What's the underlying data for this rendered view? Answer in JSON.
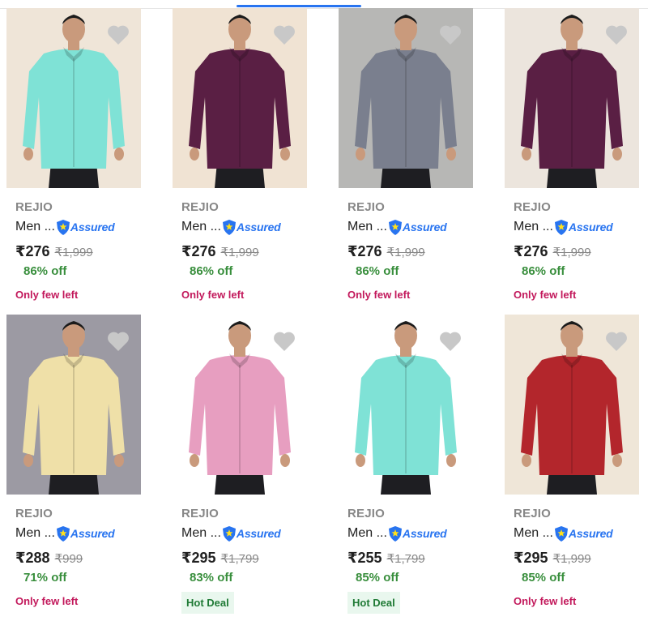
{
  "colors": {
    "accent": "#2874f0",
    "discount": "#388e3c",
    "scarcity": "#c2185b",
    "hot_deal_bg": "#e9f7ee"
  },
  "assured_label": "Assured",
  "products": [
    {
      "brand": "REJIO",
      "title": "Men ...",
      "price": "₹276",
      "mrp": "₹1,999",
      "discount": "86% off",
      "tag": "Only few left",
      "tag_type": "few",
      "shirt_color": "#7fe2d6",
      "bg": "#efe5d8"
    },
    {
      "brand": "REJIO",
      "title": "Men ...",
      "price": "₹276",
      "mrp": "₹1,999",
      "discount": "86% off",
      "tag": "Only few left",
      "tag_type": "few",
      "shirt_color": "#5a1f44",
      "bg": "#f0e3d3"
    },
    {
      "brand": "REJIO",
      "title": "Men ...",
      "price": "₹276",
      "mrp": "₹1,999",
      "discount": "86% off",
      "tag": "Only few left",
      "tag_type": "few",
      "shirt_color": "#7a7f8e",
      "bg": "#b7b7b5"
    },
    {
      "brand": "REJIO",
      "title": "Men ...",
      "price": "₹276",
      "mrp": "₹1,999",
      "discount": "86% off",
      "tag": "Only few left",
      "tag_type": "few",
      "shirt_color": "#5a1f44",
      "bg": "#ece5dd"
    },
    {
      "brand": "REJIO",
      "title": "Men ...",
      "price": "₹288",
      "mrp": "₹999",
      "discount": "71% off",
      "tag": "Only few left",
      "tag_type": "few",
      "shirt_color": "#efe0a8",
      "bg": "#9c9aa3"
    },
    {
      "brand": "REJIO",
      "title": "Men ...",
      "price": "₹295",
      "mrp": "₹1,799",
      "discount": "83% off",
      "tag": "Hot Deal",
      "tag_type": "hot",
      "shirt_color": "#e79ec0",
      "bg": "#ffffff"
    },
    {
      "brand": "REJIO",
      "title": "Men ...",
      "price": "₹255",
      "mrp": "₹1,799",
      "discount": "85% off",
      "tag": "Hot Deal",
      "tag_type": "hot",
      "shirt_color": "#7fe2d6",
      "bg": "#ffffff"
    },
    {
      "brand": "REJIO",
      "title": "Men ...",
      "price": "₹295",
      "mrp": "₹1,999",
      "discount": "85% off",
      "tag": "Only few left",
      "tag_type": "few",
      "shirt_color": "#b3262c",
      "bg": "#efe6d8"
    }
  ]
}
